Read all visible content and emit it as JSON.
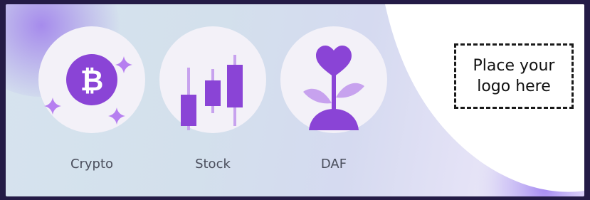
{
  "payment_methods": [
    {
      "label": "Crypto",
      "icon": "bitcoin-icon",
      "glyph": "₿"
    },
    {
      "label": "Stock",
      "icon": "candlestick-chart-icon"
    },
    {
      "label": "DAF",
      "icon": "heart-plant-icon"
    }
  ],
  "logo_placeholder": {
    "line1": "Place your",
    "line2": "logo here"
  },
  "colors": {
    "accent_purple": "#8a44d6",
    "light_purple": "#c7a2ee",
    "sparkle": "#b67ff0",
    "label_text": "#4a4e5c",
    "frame": "#241b46"
  }
}
